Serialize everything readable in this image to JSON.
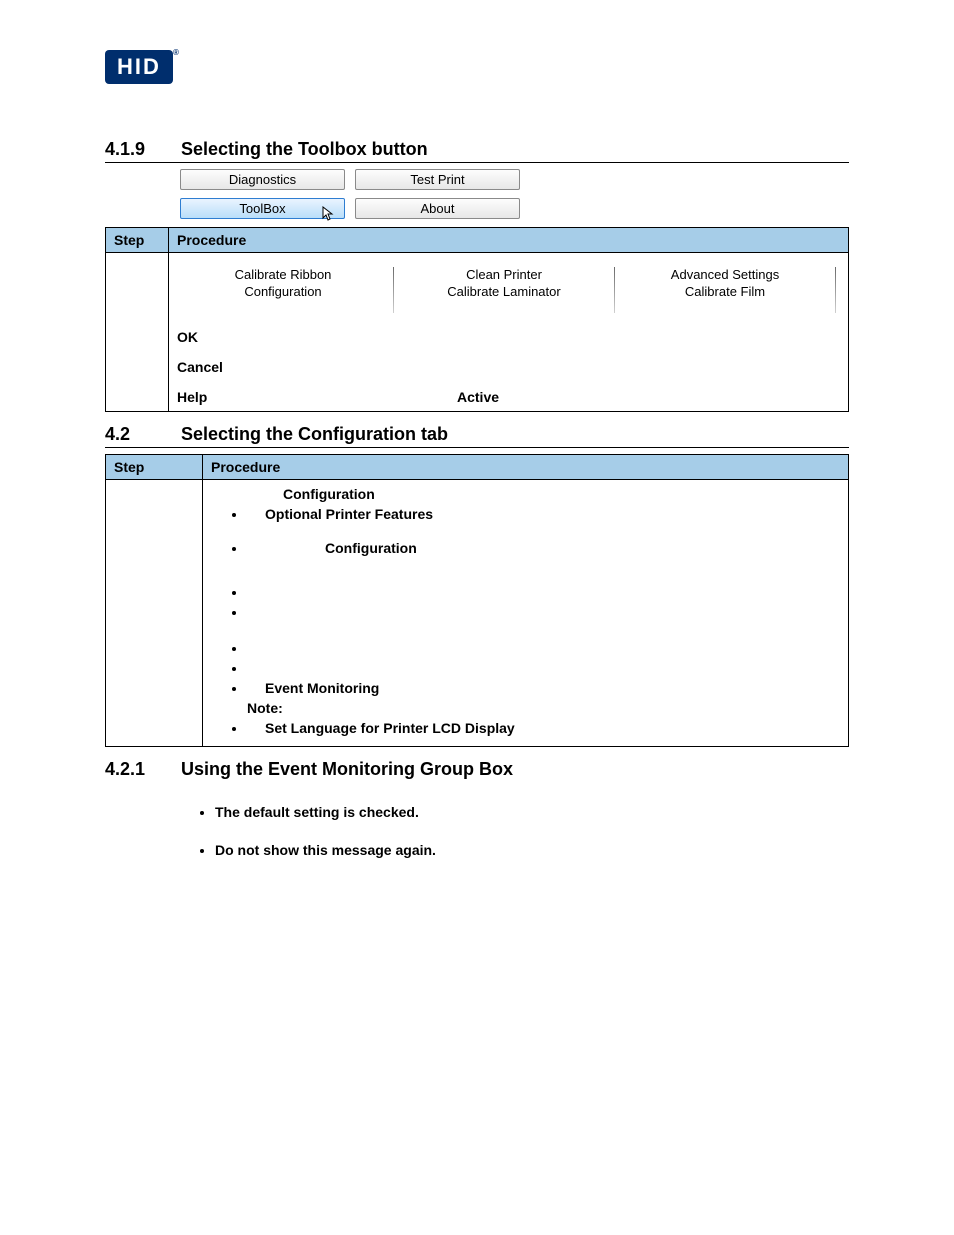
{
  "logo_text": "HID",
  "sections": {
    "s419": {
      "number": "4.1.9",
      "title": "Selecting the Toolbox button"
    },
    "s42": {
      "number": "4.2",
      "title": "Selecting the Configuration tab"
    },
    "s421": {
      "number": "4.2.1",
      "title": "Using the Event Monitoring Group Box"
    }
  },
  "buttons_grid": {
    "diagnostics": "Diagnostics",
    "test_print": "Test Print",
    "toolbox": "ToolBox",
    "about": "About"
  },
  "table_headers": {
    "step": "Step",
    "procedure": "Procedure"
  },
  "tabs": {
    "t1a": "Calibrate Ribbon",
    "t1b": "Configuration",
    "t2a": "Clean Printer",
    "t2b": "Calibrate Laminator",
    "t3a": "Advanced Settings",
    "t3b": "Calibrate Film"
  },
  "table1_body": {
    "ok": "OK",
    "cancel": "Cancel",
    "help": "Help",
    "active": "Active"
  },
  "table2_body": {
    "l1": "Configuration",
    "l2": "Optional Printer Features",
    "l3": "Configuration",
    "l4": "Event Monitoring",
    "note": "Note:",
    "l5": "Set Language for Printer LCD Display"
  },
  "body_bullets": {
    "b1": "The default setting is checked.",
    "b2": "Do not show this message again."
  }
}
